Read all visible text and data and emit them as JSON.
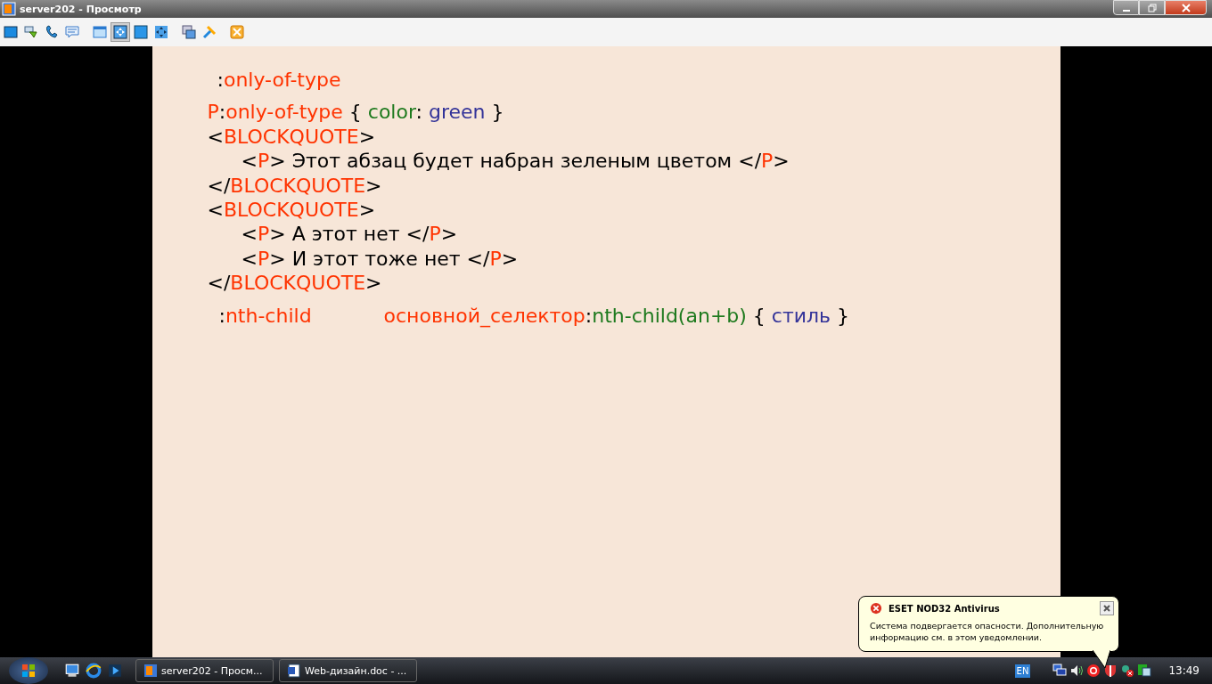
{
  "window": {
    "title": "server202 - Просмотр"
  },
  "toolbar": {
    "buttons": [
      {
        "kind": "screen",
        "selected": false
      },
      {
        "kind": "chat",
        "selected": false
      },
      {
        "kind": "phone",
        "selected": false
      },
      {
        "kind": "message",
        "selected": false
      },
      {
        "kind": "window",
        "selected": false
      },
      {
        "kind": "fit",
        "selected": true
      },
      {
        "kind": "fullscreen",
        "selected": false
      },
      {
        "kind": "scale",
        "selected": false
      },
      {
        "kind": "switch",
        "selected": false
      },
      {
        "kind": "tools",
        "selected": false
      },
      {
        "kind": "close",
        "selected": false
      }
    ]
  },
  "slide": {
    "lines": [
      {
        "kind": "heading",
        "segments": [
          {
            "kind": "plain",
            "text": ":"
          },
          {
            "kind": "tag",
            "text": "only-of-type"
          }
        ]
      },
      {
        "kind": "code",
        "segments": [
          {
            "kind": "tag",
            "text": "P"
          },
          {
            "kind": "plain",
            "text": ":"
          },
          {
            "kind": "tag",
            "text": "only-of-type"
          },
          {
            "kind": "plain",
            "text": " { "
          },
          {
            "kind": "property",
            "text": "color"
          },
          {
            "kind": "plain",
            "text": ": "
          },
          {
            "kind": "value",
            "text": "green"
          },
          {
            "kind": "plain",
            "text": " }"
          }
        ]
      },
      {
        "kind": "code",
        "segments": [
          {
            "kind": "plain",
            "text": "<"
          },
          {
            "kind": "tag",
            "text": "BLOCKQUOTE"
          },
          {
            "kind": "plain",
            "text": ">"
          }
        ]
      },
      {
        "kind": "indented",
        "segments": [
          {
            "kind": "plain",
            "text": "<"
          },
          {
            "kind": "tag",
            "text": "P"
          },
          {
            "kind": "plain",
            "text": "> Этот абзац будет набран зеленым цветом </"
          },
          {
            "kind": "tag",
            "text": "P"
          },
          {
            "kind": "plain",
            "text": ">"
          }
        ]
      },
      {
        "kind": "code",
        "segments": [
          {
            "kind": "plain",
            "text": "</"
          },
          {
            "kind": "tag",
            "text": "BLOCKQUOTE"
          },
          {
            "kind": "plain",
            "text": ">"
          }
        ]
      },
      {
        "kind": "code",
        "segments": [
          {
            "kind": "plain",
            "text": "<"
          },
          {
            "kind": "tag",
            "text": "BLOCKQUOTE"
          },
          {
            "kind": "plain",
            "text": ">"
          }
        ]
      },
      {
        "kind": "indented",
        "segments": [
          {
            "kind": "plain",
            "text": "<"
          },
          {
            "kind": "tag",
            "text": "P"
          },
          {
            "kind": "plain",
            "text": "> А этот нет </"
          },
          {
            "kind": "tag",
            "text": "P"
          },
          {
            "kind": "plain",
            "text": ">"
          }
        ]
      },
      {
        "kind": "indented",
        "segments": [
          {
            "kind": "plain",
            "text": "<"
          },
          {
            "kind": "tag",
            "text": "P"
          },
          {
            "kind": "plain",
            "text": "> И этот тоже нет </"
          },
          {
            "kind": "tag",
            "text": "P"
          },
          {
            "kind": "plain",
            "text": ">"
          }
        ]
      },
      {
        "kind": "code",
        "segments": [
          {
            "kind": "plain",
            "text": "</"
          },
          {
            "kind": "tag",
            "text": "BLOCKQUOTE"
          },
          {
            "kind": "plain",
            "text": ">"
          }
        ]
      },
      {
        "kind": "heading",
        "segments": [
          {
            "kind": "plain",
            "text": ":"
          },
          {
            "kind": "tag",
            "text": "nth-child"
          }
        ],
        "syntax": [
          {
            "kind": "tag",
            "text": "основной_селектор"
          },
          {
            "kind": "plain",
            "text": ":"
          },
          {
            "kind": "property",
            "text": "nth-child(an+b)"
          },
          {
            "kind": "plain",
            "text": " { "
          },
          {
            "kind": "value",
            "text": "стиль"
          },
          {
            "kind": "plain",
            "text": " }"
          }
        ]
      }
    ]
  },
  "notification": {
    "title": "ESET NOD32 Antivirus",
    "message": "Система подвергается опасности. Дополнительную информацию см. в этом уведомлении."
  },
  "taskbar": {
    "quick_launch": [
      {
        "kind": "desktop"
      },
      {
        "kind": "browser"
      },
      {
        "kind": "media"
      }
    ],
    "tasks": [
      {
        "kind": "viewer",
        "label": "server202 - Просм..."
      },
      {
        "kind": "word",
        "label": "Web-дизайн.doc - ..."
      }
    ],
    "language": "EN",
    "tray": [
      {
        "kind": "network"
      },
      {
        "kind": "volume"
      },
      {
        "kind": "antivirus"
      },
      {
        "kind": "shield"
      },
      {
        "kind": "network-error"
      },
      {
        "kind": "remote"
      }
    ],
    "clock": "13:49"
  }
}
